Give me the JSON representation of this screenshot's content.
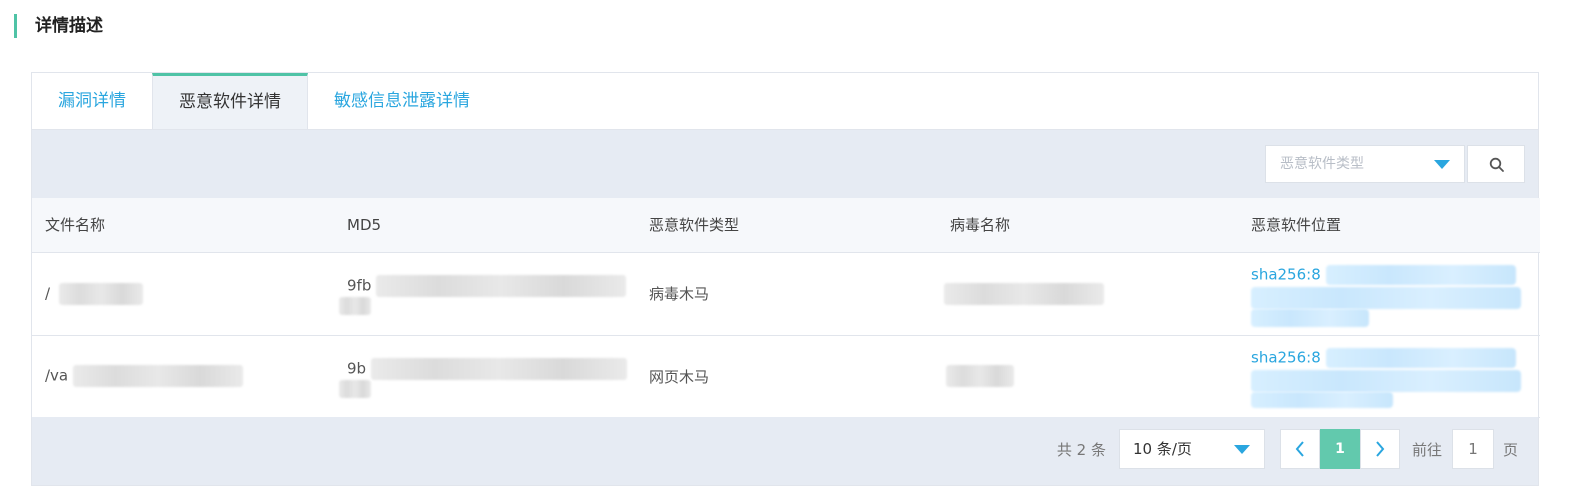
{
  "section": {
    "title": "详情描述"
  },
  "tabs": [
    {
      "label": "漏洞详情"
    },
    {
      "label": "恶意软件详情"
    },
    {
      "label": "敏感信息泄露详情"
    }
  ],
  "filter": {
    "placeholder": "恶意软件类型"
  },
  "table": {
    "headers": [
      "文件名称",
      "MD5",
      "恶意软件类型",
      "病毒名称",
      "恶意软件位置"
    ],
    "rows": [
      {
        "file": "/",
        "md5": "9fb",
        "type": "病毒木马",
        "location": "sha256:8"
      },
      {
        "file": "/va",
        "md5": "9b",
        "type": "网页木马",
        "location": "sha256:8"
      }
    ]
  },
  "pagination": {
    "total": "共 2 条",
    "page_size": "10 条/页",
    "current": "1",
    "goto_label": "前往",
    "goto_value": "1",
    "goto_suffix": "页"
  },
  "colors": {
    "accent": "#4fc3a6",
    "link": "#2aa6df",
    "toolbar_bg": "#e6ebf3"
  },
  "icons": {
    "search": "search-icon",
    "prev": "chevron-left-icon",
    "next": "chevron-right-icon",
    "dropdown": "caret-down-icon"
  }
}
